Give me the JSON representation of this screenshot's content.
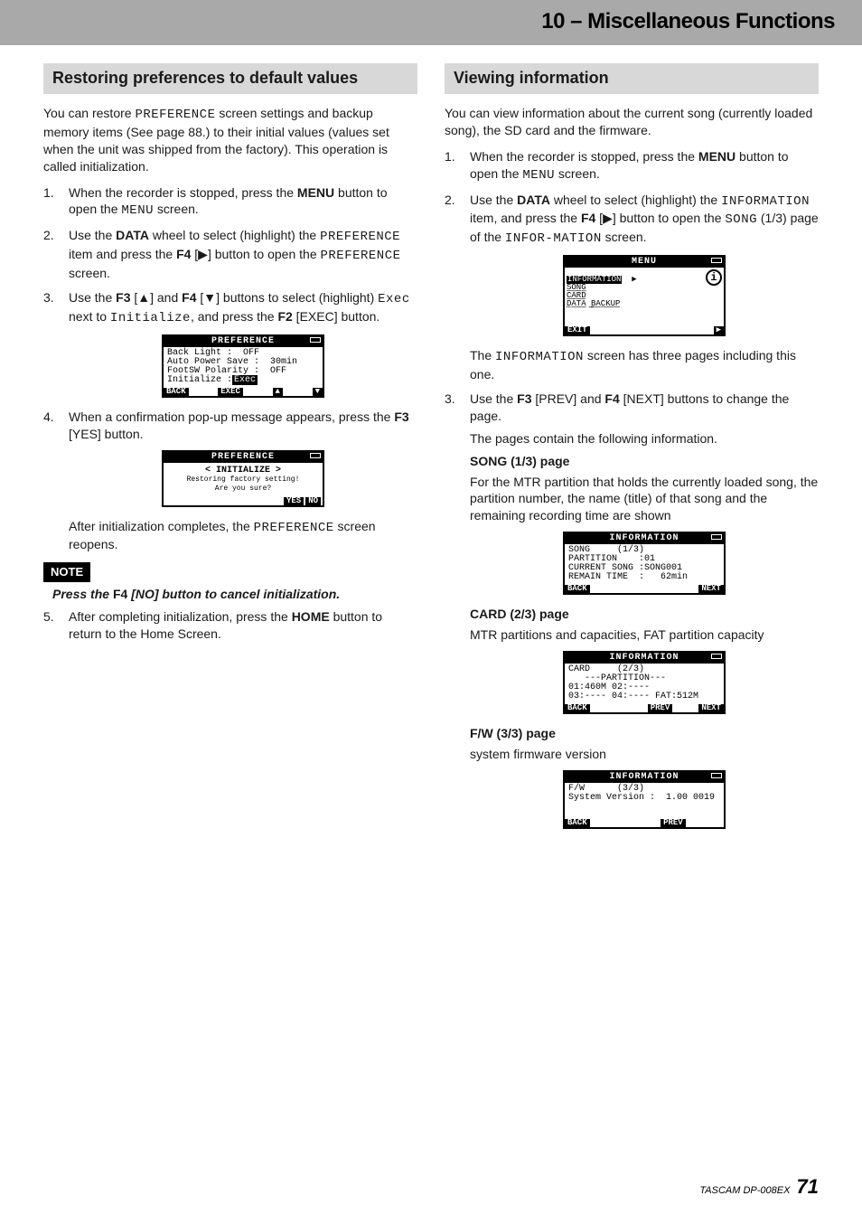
{
  "header": {
    "title": "10 – Miscellaneous Functions"
  },
  "left": {
    "heading": "Restoring preferences to default values",
    "intro": "You can restore PREFERENCE screen settings and backup memory items (See page 88.) to their initial values (values set when the unit was shipped from the factory). This operation is called initialization.",
    "intro_pref": "PREFERENCE",
    "steps": {
      "s1a": "When the recorder is stopped, press the ",
      "s1b": "MENU",
      "s1c": " button to open the ",
      "s1d": "MENU",
      "s1e": " screen.",
      "s2a": "Use the ",
      "s2b": "DATA",
      "s2c": " wheel to select (highlight) the ",
      "s2d": "PREFERENCE",
      "s2e": " item and press the ",
      "s2f": "F4",
      "s2g": " [▶] button to open the ",
      "s2h": "PREFERENCE",
      "s2i": " screen.",
      "s3a": "Use the ",
      "s3b": "F3",
      "s3c": " [▲] and ",
      "s3d": "F4",
      "s3e": " [▼] buttons to select (highlight) ",
      "s3f": "Exec",
      "s3g": " next to ",
      "s3h": "Initialize",
      "s3i": ", and press the ",
      "s3j": "F2",
      "s3k": " [EXEC] button."
    },
    "ss1": {
      "title": "PREFERENCE",
      "l1": "Back Light :  OFF",
      "l2": "Auto Power Save :  30min",
      "l3": "FootSW Polarity :  OFF",
      "l4a": "Initialize :",
      "l4b": "Exec",
      "btn1": "BACK",
      "btn2": "EXEC",
      "btn3": "▲",
      "btn4": "▼"
    },
    "s4a": "When a confirmation pop-up message appears, press the ",
    "s4b": "F3",
    "s4c": " [YES] button.",
    "ss2": {
      "title": "PREFERENCE",
      "l1": "< INITIALIZE >",
      "l2": "Restoring factory setting!",
      "l3": "Are you sure?",
      "btn1": "YES",
      "btn2": "NO"
    },
    "after": "After initialization completes, the ",
    "after_pref": "PREFERENCE",
    "after2": " screen reopens.",
    "note_label": "NOTE",
    "note_a": "Press the ",
    "note_b": "F4",
    "note_c": " [NO] button to cancel initialization.",
    "s5a": "After completing initialization, press the ",
    "s5b": "HOME",
    "s5c": " button to return to the Home Screen."
  },
  "right": {
    "heading": "Viewing information",
    "intro": "You can view information about the current song (currently loaded song), the SD card and the firmware.",
    "s1a": "When the recorder is stopped, press the ",
    "s1b": "MENU",
    "s1c": " button to open the ",
    "s1d": "MENU",
    "s1e": " screen.",
    "s2a": "Use the ",
    "s2b": "DATA",
    "s2c": " wheel to select (highlight) the ",
    "s2d": "INFORMATION",
    "s2e": " item, and press the ",
    "s2f": "F4",
    "s2g": " [▶] button to open the ",
    "s2h": "SONG",
    "s2i": " (1/3) page of the ",
    "s2j": "INFOR-MATION",
    "s2k": " screen.",
    "ssmenu": {
      "title": "MENU",
      "l1": "INFORMATION",
      "l2": "SONG",
      "l3": "CARD",
      "l4": "DATA BACKUP",
      "btn1": "EXIT",
      "btn2": "▶"
    },
    "after_menu_a": "The ",
    "after_menu_b": "INFORMATION",
    "after_menu_c": " screen has three pages including this one.",
    "s3a": "Use the ",
    "s3b": "F3",
    "s3c": " [PREV] and ",
    "s3d": "F4",
    "s3e": " [NEXT] buttons to change the page.",
    "s3f": "The pages contain the following information.",
    "song_h": "SONG (1/3) page",
    "song_p": "For the MTR partition that holds the currently loaded song, the partition number, the name (title) of that song and the remaining recording time are shown",
    "ss_song": {
      "title": "INFORMATION",
      "tab": "SONG     (1/3)",
      "l1": "PARTITION    :01",
      "l2": "CURRENT SONG :SONG001",
      "l3": "REMAIN TIME  :   62min",
      "btn1": "BACK",
      "btn2": "NEXT"
    },
    "card_h": "CARD (2/3) page",
    "card_p": "MTR partitions and capacities, FAT partition capacity",
    "ss_card": {
      "title": "INFORMATION",
      "tab": "CARD     (2/3)",
      "l1": "   ---PARTITION---",
      "l2": "01:460M 02:----",
      "l3": "03:---- 04:---- FAT:512M",
      "btn1": "BACK",
      "btn2": "PREV",
      "btn3": "NEXT"
    },
    "fw_h": "F/W (3/3) page",
    "fw_p": "system firmware version",
    "ss_fw": {
      "title": "INFORMATION",
      "tab": "F/W      (3/3)",
      "l1": "System Version :  1.00 0019",
      "btn1": "BACK",
      "btn2": "PREV"
    }
  },
  "footer": {
    "text": "TASCAM  DP-008EX",
    "page": "71"
  }
}
